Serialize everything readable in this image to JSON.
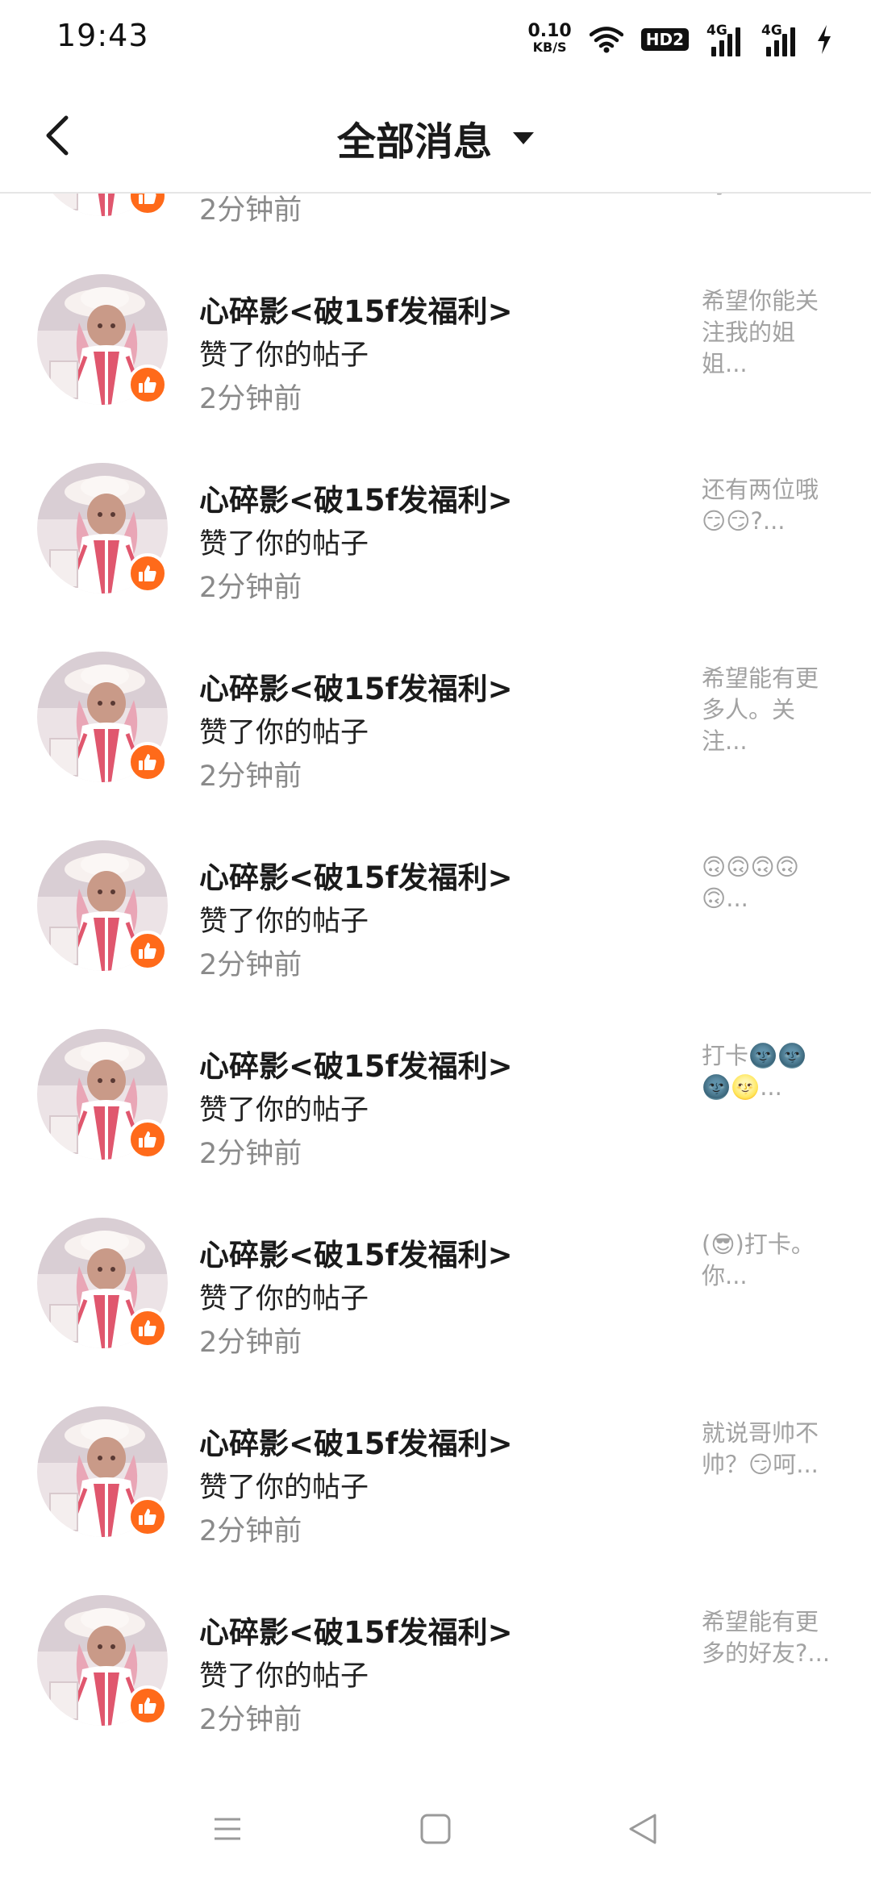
{
  "status_bar": {
    "time": "19:43",
    "net_speed_value": "0.10",
    "net_speed_unit": "KB/S",
    "hd_label": "HD2",
    "signal1_label": "4G",
    "signal2_label": "4G",
    "icons": [
      "wifi-icon",
      "signal-icon",
      "signal-icon",
      "charging-icon"
    ]
  },
  "header": {
    "title": "全部消息",
    "icons": [
      "back-arrow-icon",
      "dropdown-triangle-icon"
    ]
  },
  "colors": {
    "like_badge": "#ff6a1a",
    "time_text": "#8a8a8a",
    "preview_text": "#a2a2a2"
  },
  "notifications": [
    {
      "username": "",
      "action": "",
      "time": "2分钟前",
      "preview": "吗？..."
    },
    {
      "username": "心碎影<破15f发福利>",
      "action": "赞了你的帖子",
      "time": "2分钟前",
      "preview": "希望你能关注我的姐姐..."
    },
    {
      "username": "心碎影<破15f发福利>",
      "action": "赞了你的帖子",
      "time": "2分钟前",
      "preview": "还有两位哦😏😏?..."
    },
    {
      "username": "心碎影<破15f发福利>",
      "action": "赞了你的帖子",
      "time": "2分钟前",
      "preview": "希望能有更多人。关注..."
    },
    {
      "username": "心碎影<破15f发福利>",
      "action": "赞了你的帖子",
      "time": "2分钟前",
      "preview": "🙃🙃🙃🙃🙃..."
    },
    {
      "username": "心碎影<破15f发福利>",
      "action": "赞了你的帖子",
      "time": "2分钟前",
      "preview": "打卡🌚🌚🌚🌝..."
    },
    {
      "username": "心碎影<破15f发福利>",
      "action": "赞了你的帖子",
      "time": "2分钟前",
      "preview": "(😎)打卡。你..."
    },
    {
      "username": "心碎影<破15f发福利>",
      "action": "赞了你的帖子",
      "time": "2分钟前",
      "preview": "就说哥帅不帅？😏呵..."
    },
    {
      "username": "心碎影<破15f发福利>",
      "action": "赞了你的帖子",
      "time": "2分钟前",
      "preview": "希望能有更多的好友?..."
    }
  ],
  "nav_bar": {
    "icons": [
      "menu-icon",
      "home-square-icon",
      "back-triangle-icon"
    ]
  }
}
